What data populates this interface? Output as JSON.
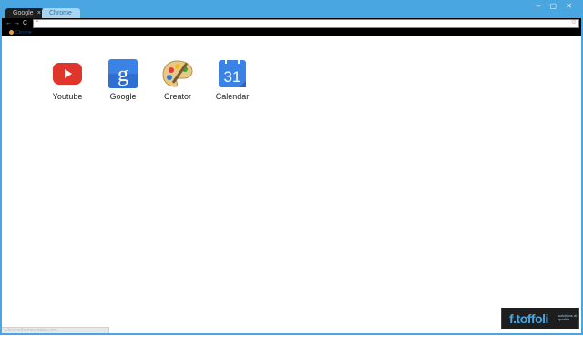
{
  "browser": {
    "tabs": [
      {
        "label": "Google",
        "active": true
      },
      {
        "label": "Chrome",
        "active": false
      }
    ],
    "tab_close_glyph": "×",
    "window_controls": "– ▢ ✕",
    "nav": {
      "back": "←",
      "forward": "→",
      "reload": "C"
    },
    "omnibox": {
      "value": "",
      "placeholder": ""
    },
    "bookmark": {
      "label": "Chrome"
    },
    "status_text": "chromethemecreator.com"
  },
  "apps": [
    {
      "label": "Youtube",
      "icon": "youtube-icon"
    },
    {
      "label": "Google",
      "icon": "google-icon"
    },
    {
      "label": "Creator",
      "icon": "palette-icon"
    },
    {
      "label": "Calendar",
      "icon": "calendar-icon",
      "day": "31"
    }
  ],
  "brand": {
    "name": "f.toffoli",
    "tagline": "solutions di qualità"
  },
  "colors": {
    "frame": "#4aa6e0",
    "toolbar": "#000000",
    "youtube": "#e0352b",
    "google": "#3b82e6",
    "calendar": "#3b82e6"
  }
}
